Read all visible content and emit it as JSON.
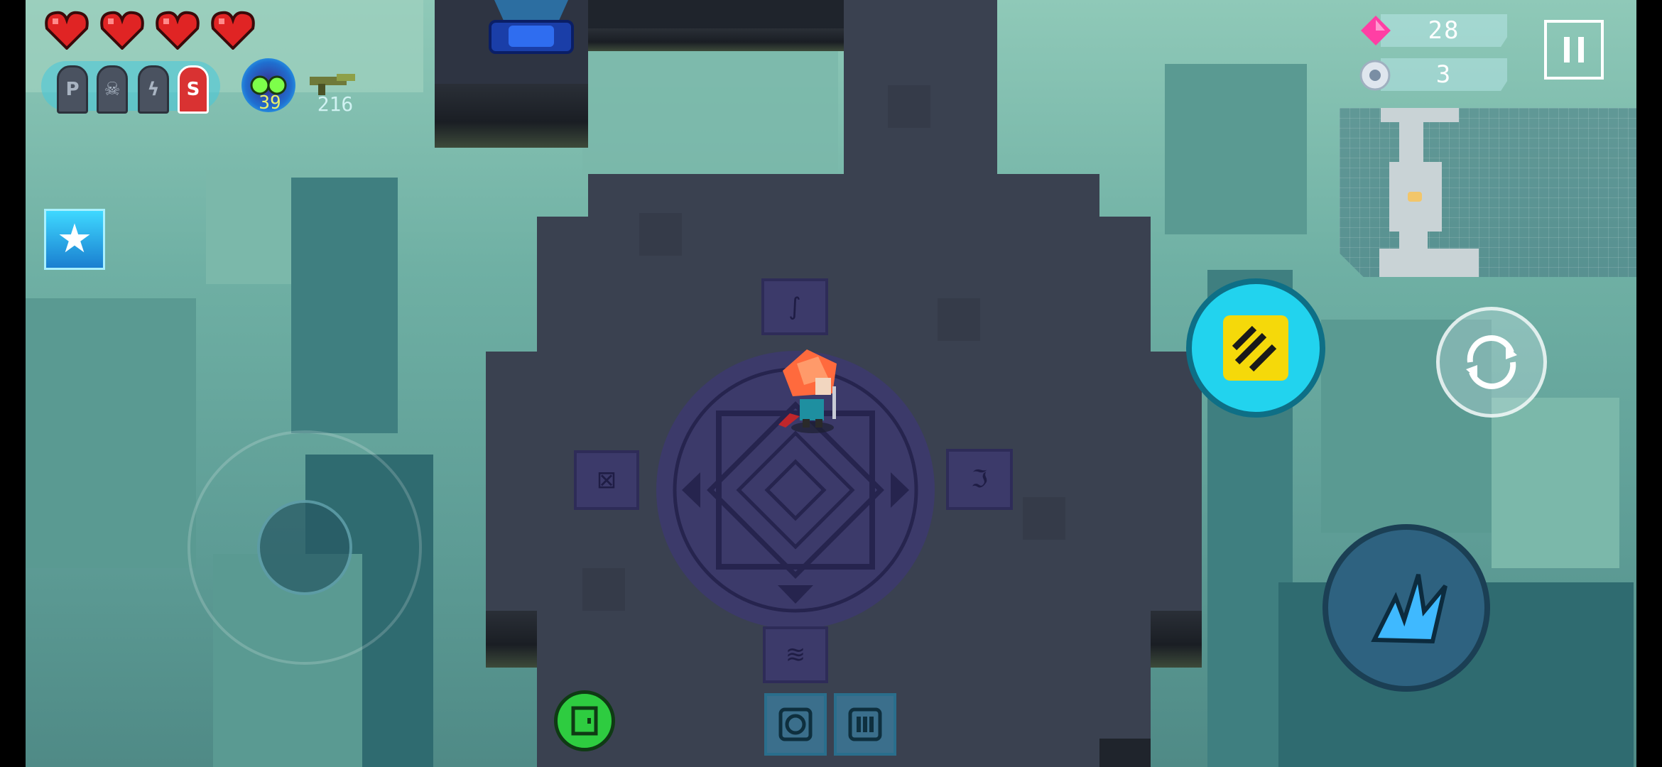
{
  "hud": {
    "hearts": 4,
    "ammo_slots": [
      {
        "letter": "P",
        "icon": "p-ammo-icon",
        "selected": false
      },
      {
        "letter": "",
        "icon": "skull-ammo-icon",
        "selected": false
      },
      {
        "letter": "",
        "icon": "lightning-ammo-icon",
        "selected": false
      },
      {
        "letter": "S",
        "icon": "s-ammo-icon",
        "selected": true
      }
    ],
    "weapon_primary_count": "39",
    "weapon_secondary_count": "216",
    "gems": "28",
    "tokens": "3"
  },
  "colors": {
    "accent": "#22d3ee",
    "heart": "#e02424",
    "gem": "#ff3fa4",
    "skill_yellow": "#f5d90a",
    "chat_green": "#2ecc40"
  },
  "icons": {
    "pause": "pause-icon",
    "star_skill": "star-icon",
    "dash": "dash-skill-icon",
    "swap": "swap-weapon-icon",
    "attack": "claw-attack-icon",
    "exit": "exit-door-icon",
    "item1": "shield-icon",
    "item2": "bullets-icon"
  }
}
